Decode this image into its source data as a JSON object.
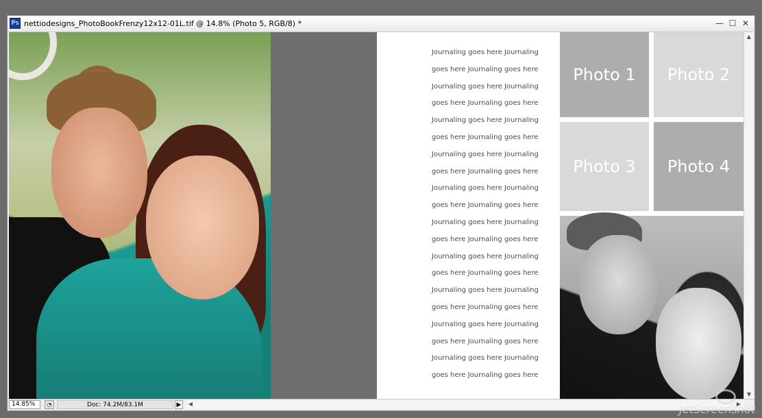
{
  "window": {
    "app_icon_text": "Ps",
    "title": "nettiodesigns_PhotoBookFrenzy12x12-01L.tif @ 14.8% (Photo 5, RGB/8) *",
    "controls": {
      "minimize": "—",
      "maximize": "☐",
      "close": "✕"
    }
  },
  "document": {
    "journal_lines": [
      "Journaling goes here Journaling",
      "goes here Journaling goes here",
      "Journaling goes here Journaling",
      "goes here Journaling goes here",
      "Journaling goes here Journaling",
      "goes here Journaling goes here",
      "Journaling goes here Journaling",
      "goes here Journaling goes here",
      "Journaling goes here Journaling",
      "goes here Journaling goes here",
      "Journaling goes here Journaling",
      "goes here Journaling goes here",
      "Journaling goes here Journaling",
      "goes here Journaling goes here",
      "Journaling goes here Journaling",
      "goes here Journaling goes here",
      "Journaling goes here Journaling",
      "goes here Journaling goes here",
      "Journaling goes here Journaling",
      "goes here Journaling goes here"
    ],
    "photo_placeholders": [
      "Photo 1",
      "Photo 2",
      "Photo 3",
      "Photo 4"
    ]
  },
  "statusbar": {
    "zoom": "14.85%",
    "doc_info": "Doc: 74.2M/83.1M",
    "menu_arrow": "▶"
  },
  "scroll": {
    "up": "▲",
    "down": "▼",
    "left": "◀",
    "right": "▶"
  },
  "watermark": "JetScreenshot"
}
